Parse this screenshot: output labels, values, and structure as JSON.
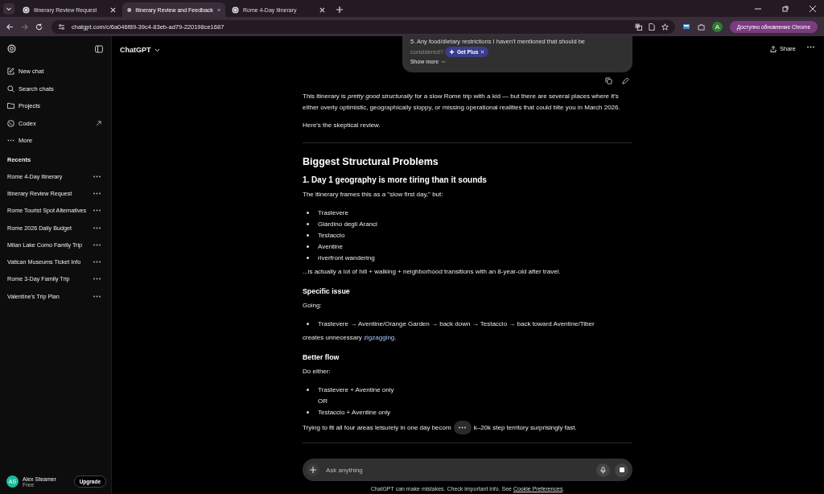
{
  "browser": {
    "tabs": [
      {
        "title": "Itinerary Review Request",
        "selected": false
      },
      {
        "title": "Itinerary Review and Feedback",
        "selected": true
      },
      {
        "title": "Rome 4-Day Itinerary",
        "selected": false
      }
    ],
    "url": "chatgpt.com/c/6a046f89-39c4-83eb-ad79-220198ce1687",
    "update_button": "Доступно обновление Chrome",
    "profile_initial": "A"
  },
  "sidebar": {
    "nav": [
      {
        "label": "New chat",
        "kind": "pencil"
      },
      {
        "label": "Search chats",
        "kind": "search"
      },
      {
        "label": "Projects",
        "kind": "folder"
      },
      {
        "label": "Codex",
        "kind": "codex"
      },
      {
        "label": "More",
        "kind": "dots"
      }
    ],
    "recents_title": "Recents",
    "recents": [
      {
        "title": "Rome 4-Day Itinerary"
      },
      {
        "title": "Itinerary Review Request"
      },
      {
        "title": "Rome Tourist Spot Alternatives"
      },
      {
        "title": "Rome 2026 Daily Budget"
      },
      {
        "title": "Milan Lake Como Family Trip"
      },
      {
        "title": "Vatican Museums Ticket Info"
      },
      {
        "title": "Rome 3-Day Family Trip"
      },
      {
        "title": "Valentine's Trip Plan"
      }
    ],
    "user": {
      "name": "Alex Steamer",
      "plan": "Free",
      "initials": "AS",
      "upgrade": "Upgrade"
    }
  },
  "header": {
    "title": "ChatGPT",
    "share": "Share"
  },
  "user_message": {
    "lines": [
      "5. Any food/dietary restrictions I haven't mentioned that should be",
      "considered?"
    ],
    "get_plus": "Get Plus",
    "show_more": "Show more"
  },
  "answer": [
    {
      "kind": "p",
      "text": "This itinerary is *pretty good structurally* for a slow Rome trip with a kid — but there are several places where it's either overly optimistic, geographically sloppy, or missing operational realities that could bite you in March 2026."
    },
    {
      "kind": "p",
      "text": "Here's the skeptical review."
    },
    {
      "kind": "hr"
    },
    {
      "kind": "h2",
      "text": "Biggest Structural Problems"
    },
    {
      "kind": "h3",
      "text": "1. Day 1 geography is more tiring than it sounds"
    },
    {
      "kind": "p",
      "text": "The itinerary frames this as a \"slow first day,\" but:"
    },
    {
      "kind": "ul",
      "items": [
        {
          "kind": "bullet",
          "text": "Trastevere"
        },
        {
          "kind": "bullet",
          "text": "Giardino degli Aranci"
        },
        {
          "kind": "bullet",
          "text": "Testaccio"
        },
        {
          "kind": "bullet",
          "text": "Aventine"
        },
        {
          "kind": "bullet",
          "text": "riverfront wandering"
        }
      ]
    },
    {
      "kind": "p",
      "text": "...is actually a lot of hill + walking + neighborhood transitions with an 8-year-old after travel."
    },
    {
      "kind": "h4",
      "text": "Specific issue"
    },
    {
      "kind": "p",
      "text": "Going:"
    },
    {
      "kind": "ul",
      "items": [
        {
          "kind": "bullet",
          "text": "Trastevere → Aventine/Orange Garden → back down → Testaccio → back toward Aventine/Tiber"
        }
      ]
    },
    {
      "kind": "link_p",
      "before": "creates unnecessary ",
      "link": "zigzagging",
      "after": "."
    },
    {
      "kind": "h4",
      "text": "Better flow"
    },
    {
      "kind": "p",
      "text": "Do either:"
    },
    {
      "kind": "ul",
      "items": [
        {
          "kind": "bullet",
          "text": "Trastevere + Aventine only"
        },
        {
          "kind": "plain",
          "text": "OR"
        },
        {
          "kind": "bullet",
          "text": "Testaccio + Aventine only"
        }
      ]
    },
    {
      "kind": "split_p",
      "before": "Trying to fit all four areas leisurely in one day becom",
      "after": "k–20k step territory surprisingly fast."
    },
    {
      "kind": "hr"
    }
  ],
  "composer": {
    "placeholder": "Ask anything"
  },
  "footer": {
    "text": "ChatGPT can make mistakes. Check important info. See ",
    "link": "Cookie Preferences",
    "end": "."
  }
}
